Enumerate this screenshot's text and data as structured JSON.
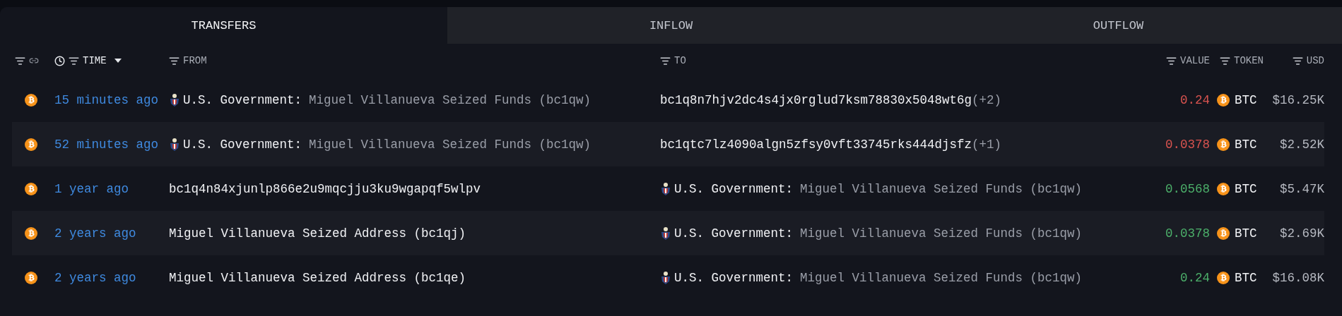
{
  "tabs": [
    {
      "label": "TRANSFERS",
      "selected": true
    },
    {
      "label": "INFLOW",
      "selected": false
    },
    {
      "label": "OUTFLOW",
      "selected": false
    }
  ],
  "columns": [
    {
      "kind": "time",
      "label": "TIME",
      "sorted": true
    },
    {
      "kind": "from",
      "label": "FROM",
      "sorted": false
    },
    {
      "kind": "to",
      "label": "TO",
      "sorted": false
    },
    {
      "kind": "value",
      "label": "VALUE",
      "sorted": false
    },
    {
      "kind": "token",
      "label": "TOKEN",
      "sorted": false
    },
    {
      "kind": "usd",
      "label": "USD",
      "sorted": false
    }
  ],
  "rows": [
    {
      "time": "15 minutes ago",
      "from": {
        "kind": "entity",
        "entity": "U.S. Government:",
        "label": "Miguel Villanueva Seized Funds (bc1qw)"
      },
      "to": {
        "kind": "address",
        "address": "bc1q8n7hjv2dc4s4jx0rglud7ksm78830x5048wt6g",
        "extra": "(+2)"
      },
      "value": "0.24",
      "color": "#d9534f",
      "token": "BTC",
      "usd": "$16.25K"
    },
    {
      "time": "52 minutes ago",
      "from": {
        "kind": "entity",
        "entity": "U.S. Government:",
        "label": "Miguel Villanueva Seized Funds (bc1qw)"
      },
      "to": {
        "kind": "address",
        "address": "bc1qtc7lz4090algn5zfsy0vft33745rks444djsfz",
        "extra": "(+1)"
      },
      "value": "0.0378",
      "color": "#d9534f",
      "token": "BTC",
      "usd": "$2.52K"
    },
    {
      "time": "1 year ago",
      "from": {
        "kind": "address",
        "address": "bc1q4n84xjunlp866e2u9mqcjju3ku9wgapqf5wlpv"
      },
      "to": {
        "kind": "entity",
        "entity": "U.S. Government:",
        "label": "Miguel Villanueva Seized Funds (bc1qw)"
      },
      "value": "0.0568",
      "color": "#4caf6a",
      "token": "BTC",
      "usd": "$5.47K"
    },
    {
      "time": "2 years ago",
      "from": {
        "kind": "address",
        "address": "Miguel Villanueva Seized Address (bc1qj)"
      },
      "to": {
        "kind": "entity",
        "entity": "U.S. Government:",
        "label": "Miguel Villanueva Seized Funds (bc1qw)"
      },
      "value": "0.0378",
      "color": "#4caf6a",
      "token": "BTC",
      "usd": "$2.69K"
    },
    {
      "time": "2 years ago",
      "from": {
        "kind": "address",
        "address": "Miguel Villanueva Seized Address (bc1qe)"
      },
      "to": {
        "kind": "entity",
        "entity": "U.S. Government:",
        "label": "Miguel Villanueva Seized Funds (bc1qw)"
      },
      "value": "0.24",
      "color": "#4caf6a",
      "token": "BTC",
      "usd": "$16.08K"
    }
  ]
}
